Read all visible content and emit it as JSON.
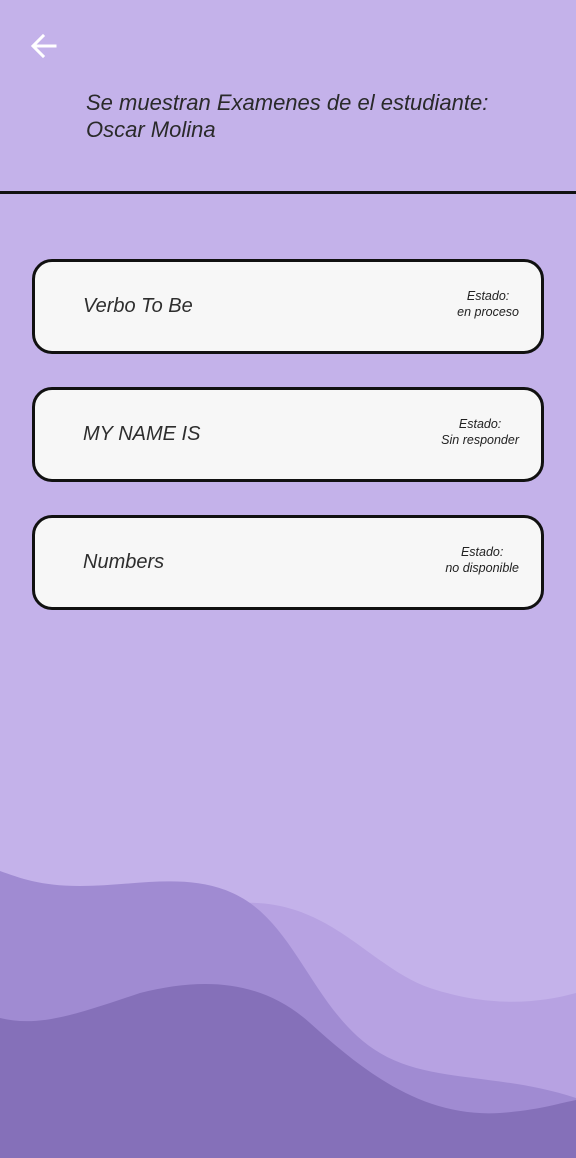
{
  "header": {
    "back_icon": "arrow-left-icon",
    "title": "Se muestran Examenes de el estudiante: Oscar Molina"
  },
  "exams": [
    {
      "name": "Verbo To Be",
      "status_label": "Estado:",
      "status_value": "en proceso"
    },
    {
      "name": "MY NAME IS",
      "status_label": "Estado:",
      "status_value": "Sin responder"
    },
    {
      "name": "Numbers",
      "status_label": "Estado:",
      "status_value": "no disponible"
    }
  ],
  "colors": {
    "background": "#c4b2ea",
    "card": "#f7f7f7",
    "wave_light": "#b7a2e2",
    "wave_mid": "#a08bd2",
    "wave_dark": "#8570b9"
  }
}
